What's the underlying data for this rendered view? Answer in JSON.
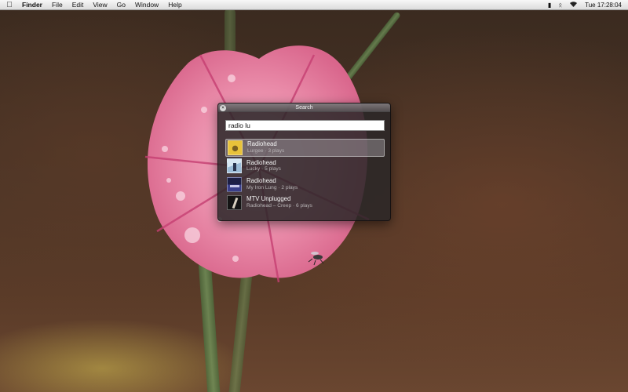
{
  "menubar": {
    "apple_icon": "apple-icon",
    "app_name": "Finder",
    "menus": [
      "File",
      "Edit",
      "View",
      "Go",
      "Window",
      "Help"
    ],
    "status_icons": [
      "battery-icon",
      "bluetooth-icon",
      "wifi-icon"
    ],
    "clock": "Tue 17:28:04"
  },
  "search_panel": {
    "title": "Search",
    "query": "radio lu",
    "results": [
      {
        "title": "Radiohead",
        "subtitle": "Lurgee · 3 plays",
        "thumb_icon": "album-art-icon",
        "selected": true
      },
      {
        "title": "Radiohead",
        "subtitle": "Lucky · 5 plays",
        "thumb_icon": "album-art-icon",
        "selected": false
      },
      {
        "title": "Radiohead",
        "subtitle": "My Iron Lung · 2 plays",
        "thumb_icon": "album-art-icon",
        "selected": false
      },
      {
        "title": "MTV Unplugged",
        "subtitle": "Radiohead – Creep · 6 plays",
        "thumb_icon": "album-art-icon",
        "selected": false
      }
    ]
  },
  "colors": {
    "panel_bg": "#2a2628",
    "selection": "#aaa5aa",
    "flower_pink": "#e88aa6"
  }
}
